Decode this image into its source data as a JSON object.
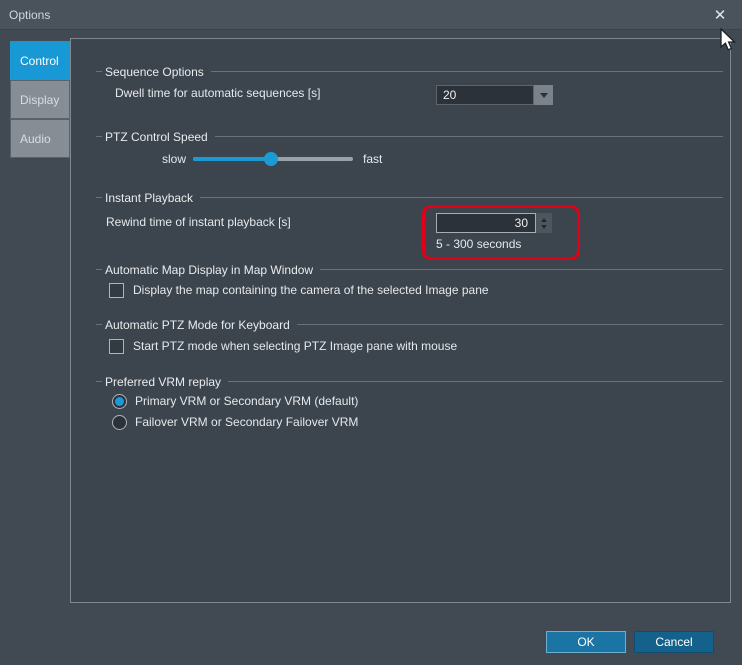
{
  "window": {
    "title": "Options",
    "close_glyph": "✕"
  },
  "tabs": [
    {
      "label": "Control",
      "active": true
    },
    {
      "label": "Display",
      "active": false
    },
    {
      "label": "Audio",
      "active": false
    }
  ],
  "sequence_options": {
    "title": "Sequence Options",
    "dwell_label": "Dwell time for automatic sequences [s]",
    "dwell_value": "20"
  },
  "ptz_control_speed": {
    "title": "PTZ Control Speed",
    "min_label": "slow",
    "max_label": "fast",
    "value_percent": 49
  },
  "instant_playback": {
    "title": "Instant Playback",
    "rewind_label": "Rewind time of instant playback [s]",
    "rewind_value": "30",
    "range_hint": "5 - 300 seconds",
    "highlighted": true
  },
  "map_display": {
    "title": "Automatic Map Display in Map Window",
    "checkbox_label": "Display the map containing the camera of the selected Image pane",
    "checked": false
  },
  "ptz_keyboard": {
    "title": "Automatic PTZ Mode for Keyboard",
    "checkbox_label": "Start PTZ mode when selecting PTZ Image pane with mouse",
    "checked": false
  },
  "vrm_replay": {
    "title": "Preferred VRM replay",
    "options": [
      {
        "label": "Primary VRM or Secondary VRM (default)",
        "selected": true
      },
      {
        "label": "Failover VRM or Secondary Failover VRM",
        "selected": false
      }
    ]
  },
  "footer": {
    "ok_label": "OK",
    "cancel_label": "Cancel"
  },
  "colors": {
    "accent_blue": "#1899d5",
    "highlight_red": "#e30016",
    "ok_button_blue": "#1a74a4",
    "cancel_button_blue": "#14618c",
    "titlebar": "#4a525b",
    "panel_background": "#3c444e"
  }
}
